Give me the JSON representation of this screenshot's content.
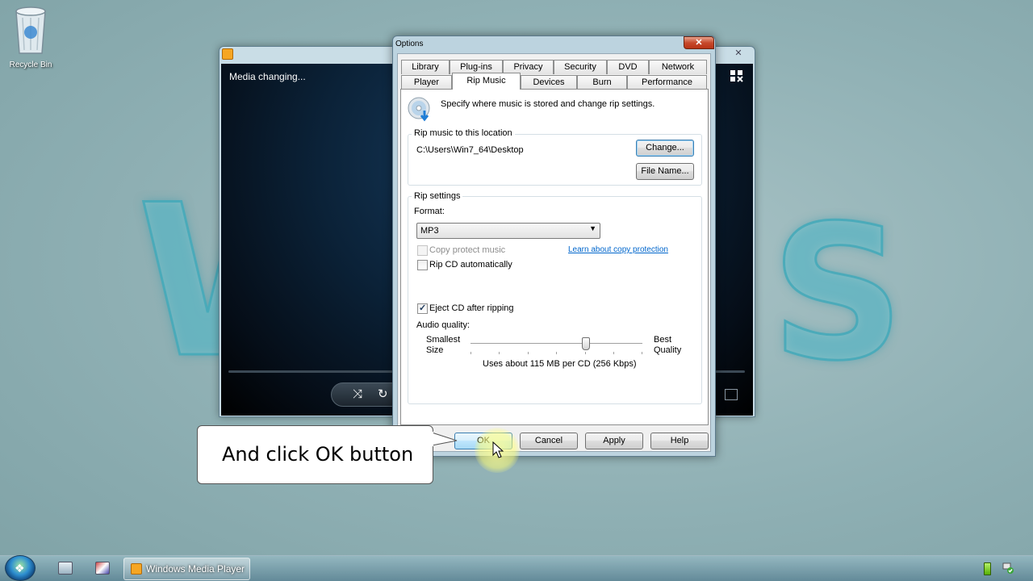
{
  "desktop": {
    "recycle_bin_label": "Recycle Bin",
    "background_letters": [
      "W",
      "S"
    ]
  },
  "wmp": {
    "status_text": "Media changing...",
    "close_label": "✕"
  },
  "dialog": {
    "title": "Options",
    "close_label": "✕",
    "tabs_row1": [
      "Library",
      "Plug-ins",
      "Privacy",
      "Security",
      "DVD",
      "Network"
    ],
    "tabs_row2": [
      "Player",
      "Rip Music",
      "Devices",
      "Burn",
      "Performance"
    ],
    "active_tab": "Rip Music",
    "description": "Specify where music is stored and change rip settings.",
    "location_group": {
      "title": "Rip music to this location",
      "path": "C:\\Users\\Win7_64\\Desktop",
      "change_label": "Change...",
      "filename_label": "File Name..."
    },
    "rip_settings": {
      "title": "Rip settings",
      "format_label": "Format:",
      "format_value": "MP3",
      "copy_protect_label": "Copy protect music",
      "copy_protect_checked": false,
      "copy_protect_enabled": false,
      "learn_link": "Learn about copy protection",
      "rip_auto_label": "Rip CD automatically",
      "rip_auto_checked": false,
      "eject_label": "Eject CD after ripping",
      "eject_checked": true,
      "audio_quality_label": "Audio quality:",
      "smallest_label_1": "Smallest",
      "smallest_label_2": "Size",
      "best_label_1": "Best",
      "best_label_2": "Quality",
      "quality_level": 0.67,
      "usage_text": "Uses about 115 MB per CD (256 Kbps)"
    },
    "buttons": {
      "ok": "OK",
      "cancel": "Cancel",
      "apply": "Apply",
      "help": "Help"
    }
  },
  "callout": {
    "text": "And click OK button"
  },
  "taskbar": {
    "active_item_label": "Windows Media Player"
  }
}
